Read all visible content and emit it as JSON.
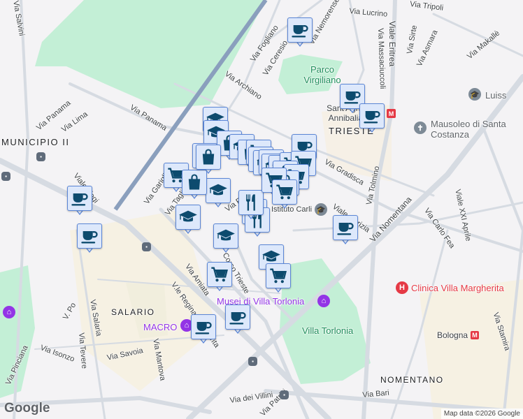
{
  "map": {
    "labels": {
      "via_salvini": "Via Salvini",
      "via_panama_1": "Via Panama",
      "via_panama_2": "Via Panama",
      "via_lima": "Via Lima",
      "municipio": "MUNICIPIO II",
      "viale_liegi": "Viale Liegi",
      "via_archiano": "Via Archiano",
      "via_fogliano": "Via Fogliano",
      "via_ceresio": "Via Ceresio",
      "via_nemorense": "Via Nemorense",
      "via_lucrino": "Via Lucrino",
      "via_tripoli": "Via Tripoli",
      "viale_eritrea": "Viale Eritrea",
      "via_massaciuccoli": "Via Massaciuccoli",
      "via_sirte": "Via Sirte",
      "via_asmara": "Via Asmara",
      "via_makalle": "Via Makallè",
      "parco_virgiliano": "Parco Virgiliano",
      "santa_agnese": "Sant'Agnese Annibaliano",
      "trieste": "TRIESTE",
      "luiss": "Luiss",
      "mausoleo": "Mausoleo di Santa Costanza",
      "via_gradisca": "Via Gradisca",
      "via_tolmino": "Via Tolmino",
      "viale_gorizia": "Viale Gorizia",
      "via_nomentana": "Via Nomentana",
      "via_carlo_fea": "Via Carlo Fea",
      "viale_xxi_aprile": "Viale XXI Aprile",
      "via_stamira": "Via Stamira",
      "clinica": "Clinica Villa Margherita",
      "bologna": "Bologna",
      "villa_torlonia_park": "Villa Torlonia",
      "musei_villa_torlonia": "Musei di Villa Torlonia",
      "nomentano": "NOMENTANO",
      "via_bari": "Via Bari",
      "via_dei_villini": "Via dei Villini",
      "via_patrizi": "Via Patrizi",
      "via_garigliano": "Via Garigliano",
      "via_tagliamento": "Via Tagliamento",
      "via_reno": "Via Reno",
      "via_amiata": "Via Amiata",
      "corso_trieste": "Corso Trieste",
      "viale_regina_margherita": "V.le Regina Margherita",
      "salario": "SALARIO",
      "macro": "MACRO",
      "via_po": "V. Po",
      "via_salaria": "Via Salaria",
      "via_tevere": "Via Tevere",
      "via_savoia": "Via Savoia",
      "via_isonzo": "Via Isonzo",
      "via_mantova": "Via Mantova",
      "via_pinciana": "Via Pinciana",
      "istituto_carli": "Istituto Carli"
    },
    "markers": [
      {
        "type": "cafe"
      },
      {
        "type": "cafe"
      },
      {
        "type": "cafe"
      },
      {
        "type": "cafe"
      },
      {
        "type": "cafe"
      },
      {
        "type": "cafe"
      },
      {
        "type": "cafe"
      },
      {
        "type": "cafe"
      },
      {
        "type": "cafe"
      },
      {
        "type": "education"
      },
      {
        "type": "education"
      },
      {
        "type": "shopping"
      },
      {
        "type": "shopping"
      },
      {
        "type": "education"
      },
      {
        "type": "shopping"
      },
      {
        "type": "grocery"
      },
      {
        "type": "shopping"
      },
      {
        "type": "education"
      },
      {
        "type": "education"
      },
      {
        "type": "education"
      },
      {
        "type": "education"
      },
      {
        "type": "grocery"
      },
      {
        "type": "grocery"
      },
      {
        "type": "shopping"
      },
      {
        "type": "grocery"
      },
      {
        "type": "shopping"
      },
      {
        "type": "grocery"
      },
      {
        "type": "restaurant"
      },
      {
        "type": "restaurant"
      },
      {
        "type": "restaurant"
      },
      {
        "type": "education"
      },
      {
        "type": "grocery"
      },
      {
        "type": "education"
      },
      {
        "type": "grocery"
      },
      {
        "type": "grocery"
      }
    ],
    "brand_logo": "Google",
    "attribution": "Map data ©2026 Google",
    "colors": {
      "marker_fill": "#dde8fb",
      "marker_border": "#5b86d6",
      "icon": "#0d4b6e",
      "park": "#c3efd6"
    }
  }
}
